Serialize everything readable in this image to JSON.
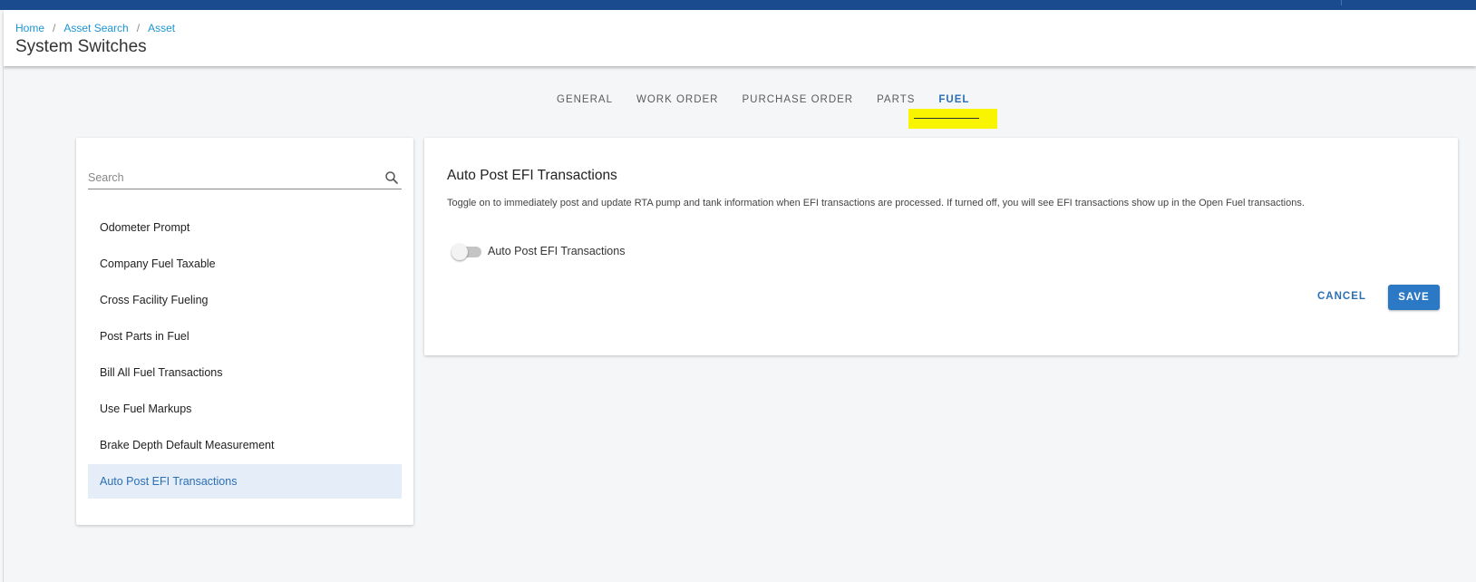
{
  "breadcrumb": {
    "items": [
      "Home",
      "Asset Search",
      "Asset"
    ],
    "separator": "/"
  },
  "page": {
    "title": "System Switches"
  },
  "tabs": [
    {
      "label": "GENERAL"
    },
    {
      "label": "WORK ORDER"
    },
    {
      "label": "PURCHASE ORDER"
    },
    {
      "label": "PARTS"
    },
    {
      "label": "FUEL",
      "active": true
    }
  ],
  "sidebar": {
    "search": {
      "placeholder": "Search",
      "value": ""
    },
    "items": [
      {
        "label": "Odometer Prompt"
      },
      {
        "label": "Company Fuel Taxable"
      },
      {
        "label": "Cross Facility Fueling"
      },
      {
        "label": "Post Parts in Fuel"
      },
      {
        "label": "Bill All Fuel Transactions"
      },
      {
        "label": "Use Fuel Markups"
      },
      {
        "label": "Brake Depth Default Measurement"
      },
      {
        "label": "Auto Post EFI Transactions",
        "active": true
      }
    ]
  },
  "main": {
    "title": "Auto Post EFI Transactions",
    "description": "Toggle on to immediately post and update RTA pump and tank information when EFI transactions are processed. If turned off, you will see EFI transactions show up in the Open Fuel transactions.",
    "toggle": {
      "label": "Auto Post EFI Transactions",
      "on": false
    },
    "cancel_label": "CANCEL",
    "save_label": "SAVE"
  },
  "colors": {
    "topbar": "#1b4b8f",
    "accent": "#2b78c4",
    "link": "#1d95d4",
    "highlight": "#f9f500",
    "active_item_bg": "#e4edf8"
  }
}
